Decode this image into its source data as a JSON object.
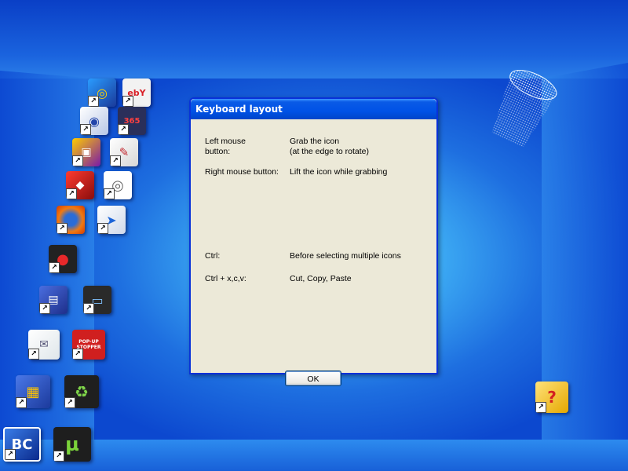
{
  "dialog": {
    "title": "Keyboard layout",
    "rows": [
      {
        "key": "Left mouse\nbutton:",
        "value": "Grab the icon\n(at the edge to rotate)"
      },
      {
        "key": "Right mouse button:",
        "value": "Lift the icon while grabbing"
      },
      {
        "key": "Ctrl:",
        "value": "Before selecting multiple icons"
      },
      {
        "key": "Ctrl + x,c,v:",
        "value": "Cut, Copy, Paste"
      }
    ],
    "ok_label": "OK"
  },
  "desktop_icons": [
    {
      "name": "app-icon-swirl",
      "label": ""
    },
    {
      "name": "ebay-icon",
      "label": "ebY"
    },
    {
      "name": "media-player-icon",
      "label": ""
    },
    {
      "name": "365-icon",
      "label": "365"
    },
    {
      "name": "photo-app-icon",
      "label": ""
    },
    {
      "name": "brush-tool-icon",
      "label": ""
    },
    {
      "name": "red-tool-icon",
      "label": ""
    },
    {
      "name": "cd-disc-icon",
      "label": ""
    },
    {
      "name": "firefox-icon",
      "label": ""
    },
    {
      "name": "shortcut-arrow-app-icon",
      "label": ""
    },
    {
      "name": "red-badge-icon",
      "label": ""
    },
    {
      "name": "floppy-save-icon",
      "label": ""
    },
    {
      "name": "monitor-icon",
      "label": ""
    },
    {
      "name": "mail-icon",
      "label": ""
    },
    {
      "name": "popup-stopper-icon",
      "label": "POP-UP STOPPER"
    },
    {
      "name": "archive-zip-icon",
      "label": ""
    },
    {
      "name": "recycle-icon",
      "label": ""
    },
    {
      "name": "bc-icon",
      "label": "BC"
    },
    {
      "name": "utorrent-icon",
      "label": "µ"
    },
    {
      "name": "help-file-icon",
      "label": "?"
    }
  ],
  "colors": {
    "dialog_bg": "#ece9d8",
    "titlebar": "#0052e6",
    "border": "#0831d9"
  }
}
